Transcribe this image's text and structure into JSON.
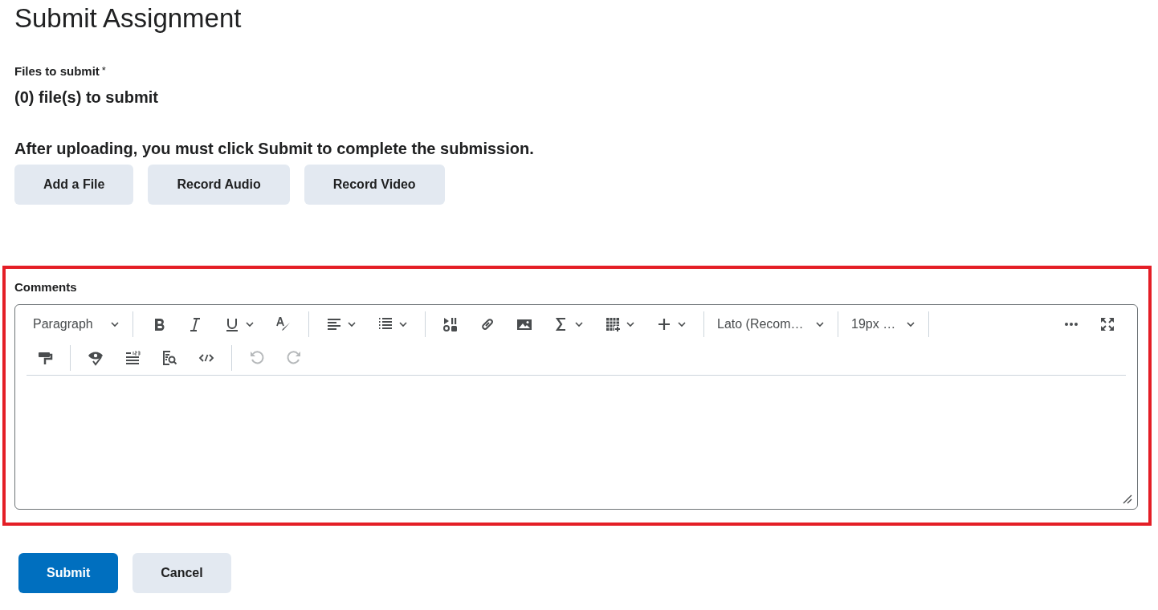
{
  "page": {
    "title": "Submit Assignment"
  },
  "files": {
    "label": "Files to submit",
    "required_mark": "*",
    "count_text": "(0) file(s) to submit"
  },
  "instruction": "After uploading, you must click Submit to complete the submission.",
  "upload_buttons": [
    "Add a File",
    "Record Audio",
    "Record Video"
  ],
  "comments": {
    "label": "Comments",
    "highlighted": true,
    "toolbar": {
      "block_format": "Paragraph",
      "font_family": "Lato (Recom…",
      "font_size": "19px …",
      "undo": {
        "disabled": true
      },
      "redo": {
        "disabled": true
      }
    }
  },
  "actions": [
    {
      "label": "Submit",
      "kind": "primary"
    },
    {
      "label": "Cancel",
      "kind": "secondary"
    }
  ]
}
